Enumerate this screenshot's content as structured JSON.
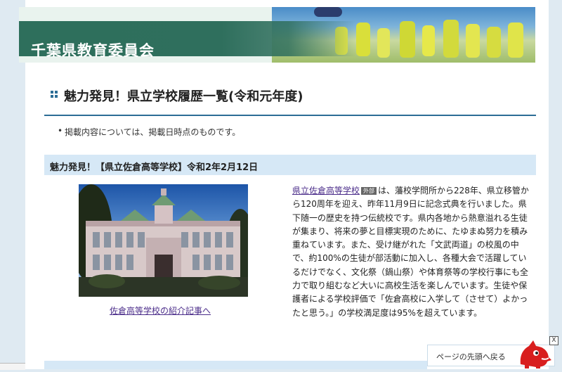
{
  "header": {
    "title": "千葉県教育委員会"
  },
  "page": {
    "heading": "魅力発見！県立学校履歴一覧(令和元年度)",
    "note": "掲載内容については、掲載日時点のものです。"
  },
  "article": {
    "section_title": "魅力発見！【県立佐倉高等学校】令和2年2月12日",
    "photo_caption": "佐倉高等学校の紹介記事へ",
    "school_link": "県立佐倉高等学校",
    "external_badge": "外部",
    "description": "は、藩校学問所から228年、県立移管から120周年を迎え、昨年11月9日に記念式典を行いました。県下随一の歴史を持つ伝統校です。県内各地から熱意溢れる生徒が集まり、将来の夢と目標実現のために、たゆまぬ努力を積み重ねています。また、受け継がれた「文武両道」の校風の中で、約100%の生徒が部活動に加入し、各種大会で活躍しているだけでなく、文化祭（鍋山祭）や体育祭等の学校行事にも全力で取り組むなど大いに高校生活を楽しんでいます。生徒や保護者による学校評価で「佐倉高校に入学して（させて）よかったと思う。」の学校満足度は95%を超えています。"
  },
  "footer": {
    "back_to_top": "ページの先頭へ戻る",
    "close_label": "X"
  },
  "colors": {
    "banner_green": "#2e6f5c",
    "heading_rule": "#2c6d96",
    "section_bg": "#d6e8f6",
    "link": "#4b2d8a"
  }
}
